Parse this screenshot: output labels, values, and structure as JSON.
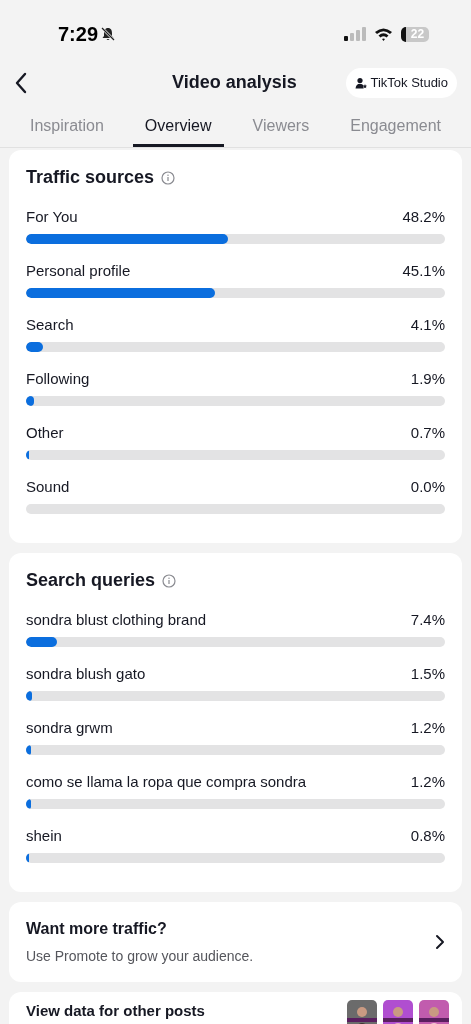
{
  "status_bar": {
    "time": "7:29",
    "battery": "22"
  },
  "header": {
    "title": "Video analysis",
    "studio_button": "TikTok Studio"
  },
  "tabs": [
    {
      "label": "Inspiration",
      "selected": false
    },
    {
      "label": "Overview",
      "selected": true
    },
    {
      "label": "Viewers",
      "selected": false
    },
    {
      "label": "Engagement",
      "selected": false
    }
  ],
  "traffic_sources": {
    "title": "Traffic sources",
    "rows": [
      {
        "label": "For You",
        "value": "48.2%",
        "level": 0.482
      },
      {
        "label": "Personal profile",
        "value": "45.1%",
        "level": 0.451
      },
      {
        "label": "Search",
        "value": "4.1%",
        "level": 0.041
      },
      {
        "label": "Following",
        "value": "1.9%",
        "level": 0.019
      },
      {
        "label": "Other",
        "value": "0.7%",
        "level": 0.007
      },
      {
        "label": "Sound",
        "value": "0.0%",
        "level": 0
      }
    ]
  },
  "search_queries": {
    "title": "Search queries",
    "rows": [
      {
        "label": "sondra blust clothing brand",
        "value": "7.4%",
        "level": 0.074
      },
      {
        "label": "sondra blush gato",
        "value": "1.5%",
        "level": 0.015
      },
      {
        "label": "sondra grwm",
        "value": "1.2%",
        "level": 0.012
      },
      {
        "label": "como se llama la ropa que compra sondra",
        "value": "1.2%",
        "level": 0.012
      },
      {
        "label": "shein",
        "value": "0.8%",
        "level": 0.008
      }
    ]
  },
  "promote": {
    "title": "Want more traffic?",
    "subtitle": "Use Promote to grow your audience."
  },
  "other_posts": {
    "title": "View data for other posts"
  }
}
